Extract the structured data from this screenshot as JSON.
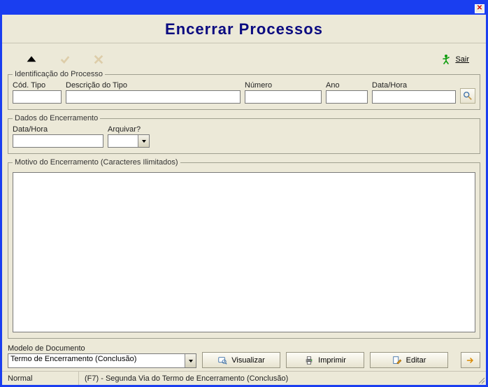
{
  "window": {
    "title": ""
  },
  "header": {
    "title": "Encerrar Processos"
  },
  "toolbar": {
    "sair_label": "Sair"
  },
  "ident": {
    "legend": "Identificação do Processo",
    "cod_tipo_label": "Cód. Tipo",
    "cod_tipo_value": "",
    "descricao_label": "Descrição do Tipo",
    "descricao_value": "",
    "numero_label": "Número",
    "numero_value": "",
    "ano_label": "Ano",
    "ano_value": "",
    "datahora_label": "Data/Hora",
    "datahora_value": ""
  },
  "encerramento": {
    "legend": "Dados do Encerramento",
    "datahora_label": "Data/Hora",
    "datahora_value": "",
    "arquivar_label": "Arquivar?",
    "arquivar_value": ""
  },
  "motivo": {
    "legend": "Motivo do Encerramento (Caracteres Ilimitados)",
    "value": ""
  },
  "bottom": {
    "modelo_label": "Modelo de Documento",
    "modelo_value": "Termo de Encerramento (Conclusão)",
    "visualizar": "Visualizar",
    "imprimir": "Imprimir",
    "editar": "Editar"
  },
  "status": {
    "mode": "Normal",
    "hint": "(F7) - Segunda Via do Termo de Encerramento (Conclusão)"
  }
}
